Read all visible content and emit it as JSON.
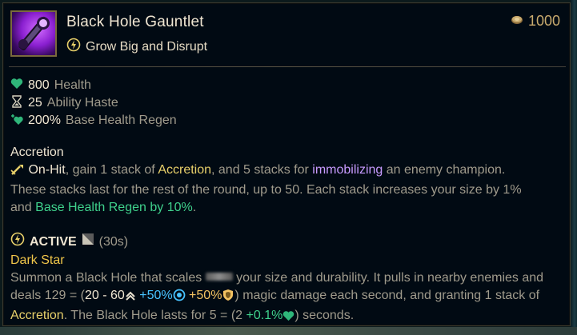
{
  "item": {
    "name": "Black Hole Gauntlet",
    "subtitle": "Grow Big and Disrupt",
    "cost": "1000"
  },
  "stats": [
    {
      "value": "800",
      "label": "Health",
      "icon": "heart-icon"
    },
    {
      "value": "25",
      "label": "Ability Haste",
      "icon": "hourglass-icon"
    },
    {
      "value": "200%",
      "label": "Base Health Regen",
      "icon": "health-regen-icon"
    }
  ],
  "passive": {
    "name": "Accretion",
    "line1": {
      "onhit": "On-Hit",
      "t1": ", gain 1 stack of ",
      "accretion": "Accretion",
      "t2": ", and 5 stacks for ",
      "immobilizing": "immobilizing",
      "t3": " an enemy champion."
    },
    "line2": "These stacks last for the rest of the round, up to 50. Each stack increases your size by 1%",
    "line3": {
      "t1": "and ",
      "regen": "Base Health Regen by 10%",
      "t2": "."
    }
  },
  "active": {
    "label": "ACTIVE",
    "cooldown": "(30s)",
    "name": "Dark Star",
    "line1": {
      "t1": "Summon a Black Hole that scales ",
      "t2": " your size and durability. It pulls in nearby enemies and"
    },
    "line2": {
      "t1": "deals 129 = (",
      "range": "20 - 60",
      "ap": "+50%",
      "bonus": "+50%",
      "t2": ") magic damage each second, and granting 1 stack of"
    },
    "line3": {
      "accretion": "Accretion",
      "t1": ". The Black Hole lasts for 5 = (2 ",
      "scale": "+0.1%",
      "t2": ") seconds."
    }
  },
  "colors": {
    "background": "#010a13",
    "title": "#f0e6d2",
    "gold": "#c8aa6e",
    "green": "#3fd18c",
    "purple": "#c89bff",
    "cyan": "#48c3ff"
  }
}
